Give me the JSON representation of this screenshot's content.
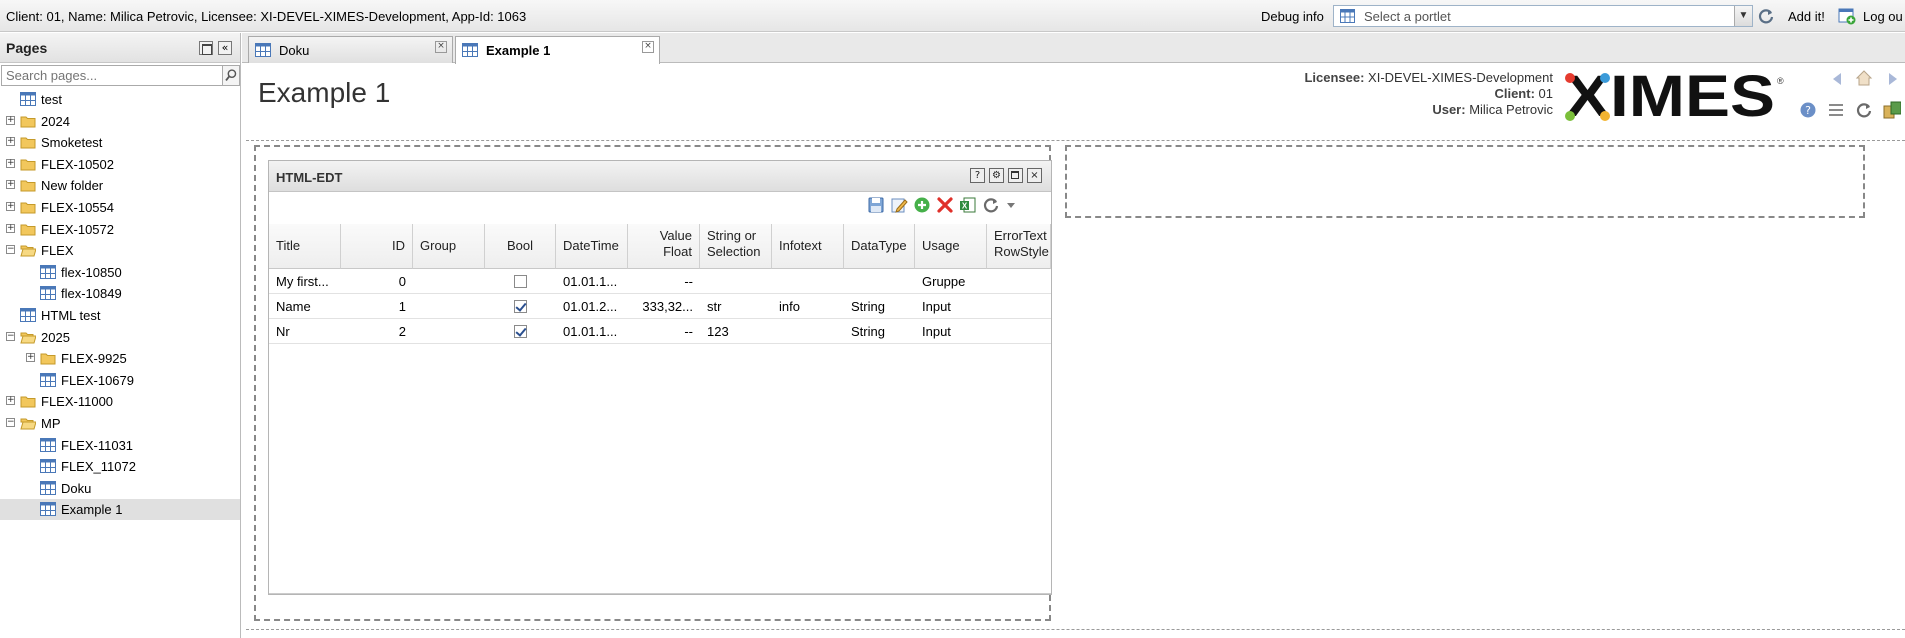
{
  "topbar": {
    "client_info": "Client: 01, Name: Milica Petrovic, Licensee: XI-DEVEL-XIMES-Development, App-Id: 1063",
    "debug_info": "Debug info",
    "portlet_placeholder": "Select a portlet",
    "add_it": "Add it!",
    "logout": "Log ou"
  },
  "sidebar": {
    "title": "Pages",
    "search_placeholder": "Search pages...",
    "tree": [
      {
        "label": "test",
        "type": "page",
        "level": 0,
        "expander": ""
      },
      {
        "label": "2024",
        "type": "folder",
        "level": 0,
        "expander": "+"
      },
      {
        "label": "Smoketest",
        "type": "folder",
        "level": 0,
        "expander": "+"
      },
      {
        "label": "FLEX-10502",
        "type": "folder",
        "level": 0,
        "expander": "+"
      },
      {
        "label": "New folder",
        "type": "folder",
        "level": 0,
        "expander": "+"
      },
      {
        "label": "FLEX-10554",
        "type": "folder",
        "level": 0,
        "expander": "+"
      },
      {
        "label": "FLEX-10572",
        "type": "folder",
        "level": 0,
        "expander": "+"
      },
      {
        "label": "FLEX",
        "type": "folder-open",
        "level": 0,
        "expander": "-"
      },
      {
        "label": "flex-10850",
        "type": "page",
        "level": 1,
        "expander": ""
      },
      {
        "label": "flex-10849",
        "type": "page",
        "level": 1,
        "expander": ""
      },
      {
        "label": "HTML test",
        "type": "page",
        "level": 0,
        "expander": ""
      },
      {
        "label": "2025",
        "type": "folder-open",
        "level": 0,
        "expander": "-"
      },
      {
        "label": "FLEX-9925",
        "type": "folder",
        "level": 1,
        "expander": "+"
      },
      {
        "label": "FLEX-10679",
        "type": "page",
        "level": 1,
        "expander": ""
      },
      {
        "label": "FLEX-11000",
        "type": "folder",
        "level": 0,
        "expander": "+"
      },
      {
        "label": "MP",
        "type": "folder-open",
        "level": 0,
        "expander": "-"
      },
      {
        "label": "FLEX-11031",
        "type": "page",
        "level": 1,
        "expander": ""
      },
      {
        "label": "FLEX_11072",
        "type": "page",
        "level": 1,
        "expander": ""
      },
      {
        "label": "Doku",
        "type": "page",
        "level": 1,
        "expander": ""
      },
      {
        "label": "Example 1",
        "type": "page",
        "level": 1,
        "expander": "",
        "selected": true
      }
    ]
  },
  "tabs": [
    {
      "label": "Doku",
      "active": false
    },
    {
      "label": "Example 1",
      "active": true
    }
  ],
  "page": {
    "title": "Example 1",
    "licensee_label": "Licensee:",
    "licensee_value": "XI-DEVEL-XIMES-Development",
    "client_label": "Client:",
    "client_value": "01",
    "user_label": "User:",
    "user_value": "Milica Petrovic",
    "logo_text": "XIMES"
  },
  "portlet": {
    "title": "HTML-EDT",
    "columns": [
      "Title",
      "ID",
      "Group",
      "Bool",
      "DateTime",
      "Value Float",
      "String or Selection",
      "Infotext",
      "DataType",
      "Usage",
      "ErrorText RowStyle"
    ],
    "rows": [
      {
        "title": "My first...",
        "id": "0",
        "group": "",
        "bool": false,
        "datetime": "01.01.1...",
        "value_float": "--",
        "string": "",
        "infotext": "",
        "datatype": "",
        "usage": "Gruppe",
        "errortext": ""
      },
      {
        "title": "Name",
        "id": "1",
        "group": "",
        "bool": true,
        "datetime": "01.01.2...",
        "value_float": "333,32...",
        "string": "str",
        "infotext": "info",
        "datatype": "String",
        "usage": "Input",
        "errortext": ""
      },
      {
        "title": "Nr",
        "id": "2",
        "group": "",
        "bool": true,
        "datetime": "01.01.1...",
        "value_float": "--",
        "string": "123",
        "infotext": "",
        "datatype": "String",
        "usage": "Input",
        "errortext": ""
      }
    ]
  },
  "colors": {
    "accent": "#2a4f8f",
    "folder": "#f2c75c",
    "page_icon": "#4a78b8"
  }
}
